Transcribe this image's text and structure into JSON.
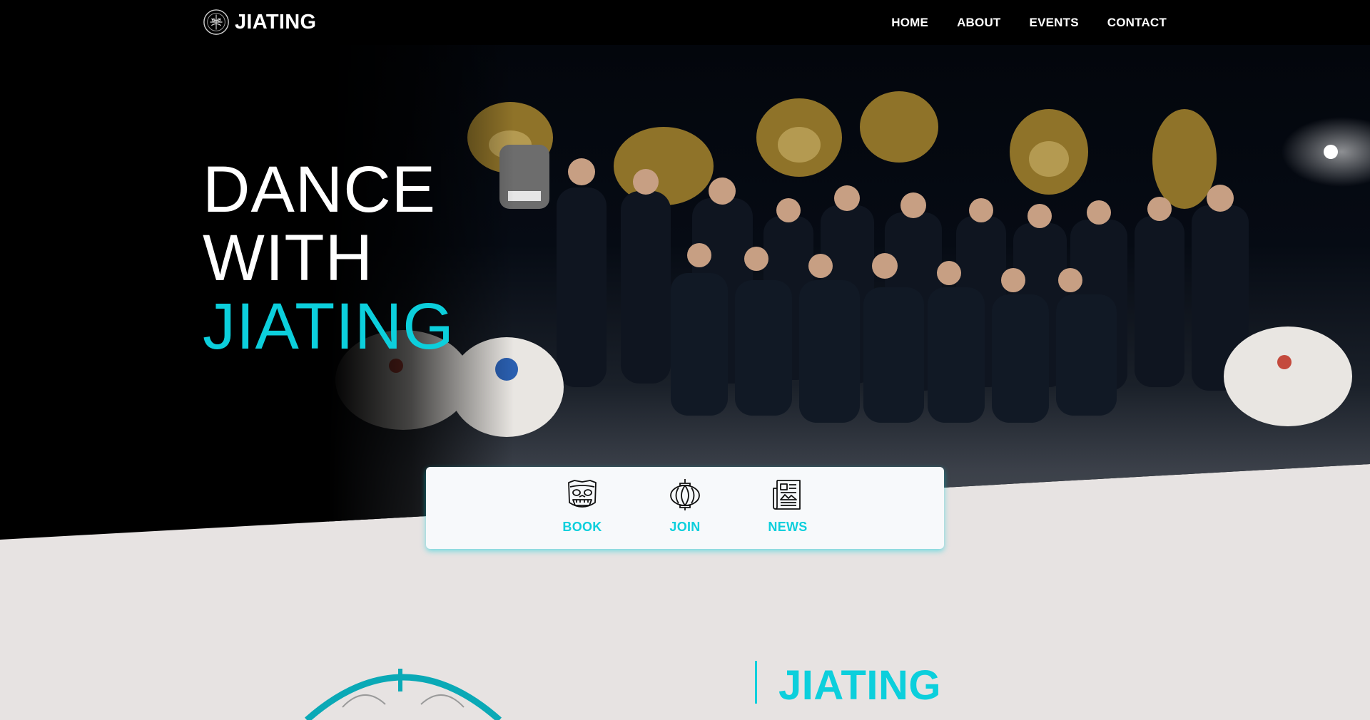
{
  "brand": {
    "name": "JIATING",
    "logo_icon": "jiating-logo-icon"
  },
  "nav": {
    "items": [
      {
        "label": "HOME"
      },
      {
        "label": "ABOUT"
      },
      {
        "label": "EVENTS"
      },
      {
        "label": "CONTACT"
      }
    ]
  },
  "hero": {
    "title_line1": "DANCE",
    "title_line2": "WITH",
    "title_line3": "JIATING",
    "image_icon": "team-group-photo"
  },
  "quick_links": [
    {
      "label": "BOOK",
      "icon": "lion-head-icon"
    },
    {
      "label": "JOIN",
      "icon": "lantern-icon"
    },
    {
      "label": "NEWS",
      "icon": "newspaper-icon"
    }
  ],
  "about": {
    "title": "JIATING",
    "emblem_icon": "emblem-icon"
  },
  "colors": {
    "accent": "#0ccfdc",
    "nav_bg": "#000000",
    "page_bg": "#e7e3e2",
    "card_bg": "#f7f9fb"
  }
}
